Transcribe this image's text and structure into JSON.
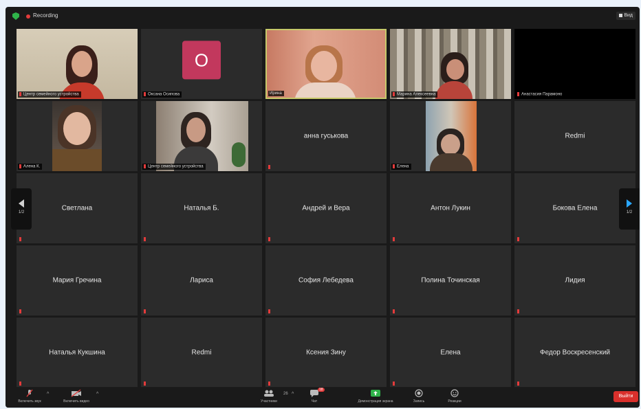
{
  "topbar": {
    "recording_label": "Recording",
    "view_label": "Вид"
  },
  "tiles": [
    {
      "type": "video",
      "tag": "Центр семейного устройства"
    },
    {
      "type": "avatar",
      "avatar_letter": "О",
      "tag": "Оксана Осипова"
    },
    {
      "type": "video",
      "tag": "Ирина",
      "active": true
    },
    {
      "type": "video",
      "tag": "Марина Алексеевна"
    },
    {
      "type": "black",
      "tag": "Анастасия Парамоно"
    },
    {
      "type": "video",
      "tag": "Алена К."
    },
    {
      "type": "video",
      "tag": "Центр семейного устройства"
    },
    {
      "type": "name",
      "name": "анна гуськова"
    },
    {
      "type": "video",
      "tag": "Елена"
    },
    {
      "type": "name",
      "name": "Redmi"
    },
    {
      "type": "name",
      "name": "Светлана"
    },
    {
      "type": "name",
      "name": "Наталья Б."
    },
    {
      "type": "name",
      "name": "Андрей и Вера"
    },
    {
      "type": "name",
      "name": "Антон Лукин"
    },
    {
      "type": "name",
      "name": "Бокова Елена"
    },
    {
      "type": "name",
      "name": "Мария Гречина"
    },
    {
      "type": "name",
      "name": "Лариса"
    },
    {
      "type": "name",
      "name": "София Лебедева"
    },
    {
      "type": "name",
      "name": "Полина Точинская"
    },
    {
      "type": "name",
      "name": "Лидия"
    },
    {
      "type": "name",
      "name": "Наталья Кукшина"
    },
    {
      "type": "name",
      "name": "Redmi"
    },
    {
      "type": "name",
      "name": "Ксения Зину"
    },
    {
      "type": "name",
      "name": "Елена"
    },
    {
      "type": "name",
      "name": "Федор Воскресенский"
    }
  ],
  "pager": {
    "left_label": "1/2",
    "right_label": "1/2"
  },
  "toolbar": {
    "mute_label": "Включить звук",
    "video_label": "Включить видео",
    "participants_label": "Участники",
    "participants_count": "26",
    "chat_label": "Чат",
    "chat_badge": "18",
    "share_label": "Демонстрация экрана",
    "record_label": "Запись",
    "reactions_label": "Реакции",
    "leave_label": "Выйти"
  },
  "colors": {
    "background": "#1a1a1a",
    "tile": "#2b2b2b",
    "active_border": "#c7c96a",
    "avatar": "#c2385d",
    "leave": "#d9302c",
    "share_icon": "#2fb34a"
  }
}
